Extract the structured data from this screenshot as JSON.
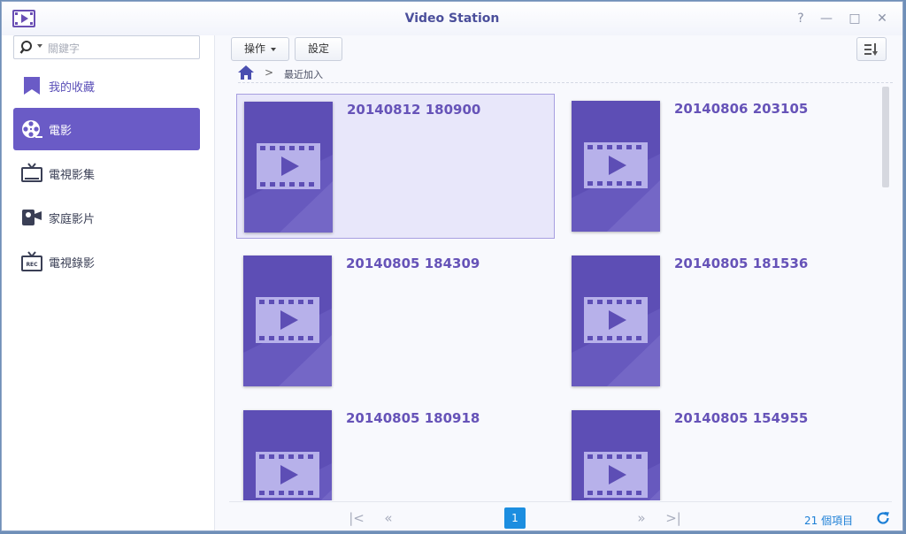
{
  "window": {
    "title": "Video Station",
    "controls": {
      "help": "?",
      "minimize": "—",
      "maximize": "□",
      "close": "✕"
    }
  },
  "sidebar": {
    "search_placeholder": "關鍵字",
    "items": [
      {
        "label": "我的收藏",
        "icon": "bookmark-icon",
        "active": false
      },
      {
        "label": "電影",
        "icon": "film-reel-icon",
        "active": true
      },
      {
        "label": "電視影集",
        "icon": "tv-icon",
        "active": false
      },
      {
        "label": "家庭影片",
        "icon": "camcorder-icon",
        "active": false
      },
      {
        "label": "電視錄影",
        "icon": "tv-recording-icon",
        "active": false
      }
    ]
  },
  "toolbar": {
    "action_label": "操作",
    "settings_label": "設定",
    "sort_icon": "sort-icon"
  },
  "breadcrumb": {
    "home_icon": "home-icon",
    "separator": ">",
    "current": "最近加入"
  },
  "videos": [
    {
      "title": "20140812 180900",
      "selected": true
    },
    {
      "title": "20140806 203105",
      "selected": false
    },
    {
      "title": "20140805 184309",
      "selected": false
    },
    {
      "title": "20140805 181536",
      "selected": false
    },
    {
      "title": "20140805 180918",
      "selected": false
    },
    {
      "title": "20140805 154955",
      "selected": false
    }
  ],
  "pagination": {
    "first": "|<",
    "prev": "«",
    "current_page": "1",
    "next": "»",
    "last": ">|",
    "item_count": "21 個項目"
  },
  "colors": {
    "accent": "#6a5bc6",
    "title_text": "#6653b8",
    "poster_bg": "#5d4eb5",
    "page_active": "#1c8ee0"
  }
}
